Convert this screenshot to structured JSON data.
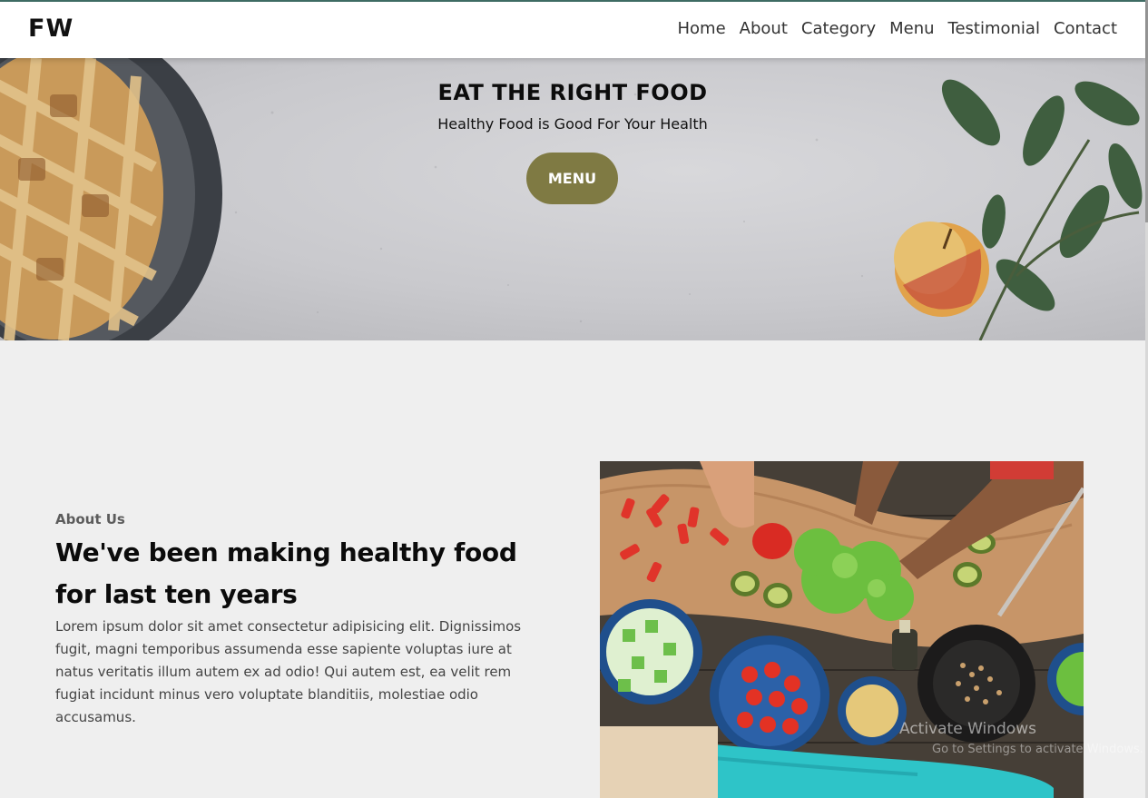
{
  "navbar": {
    "brand": "FW",
    "links": [
      "Home",
      "About",
      "Category",
      "Menu",
      "Testimonial",
      "Contact"
    ]
  },
  "hero": {
    "title": "EAT THE RIGHT FOOD",
    "subtitle": "Healthy Food is Good For Your Health",
    "button_label": "MENU"
  },
  "about": {
    "label": "About Us",
    "heading": "We've been making healthy food for last ten years",
    "paragraph": "Lorem ipsum dolor sit amet consectetur adipisicing elit. Dignissimos fugit, magni temporibus assumenda esse sapiente voluptas iure at natus veritatis illum autem ex ad odio! Qui autem est, ea velit rem fugiat incidunt minus vero voluptate blanditiis, molestiae odio accusamus."
  },
  "watermark": {
    "line1": "Activate Windows",
    "line2": "Go to Settings to activate Windows."
  },
  "colors": {
    "accent": "#7f7a43",
    "navbar_border": "#3e6b63",
    "page_bg": "#efefef"
  }
}
